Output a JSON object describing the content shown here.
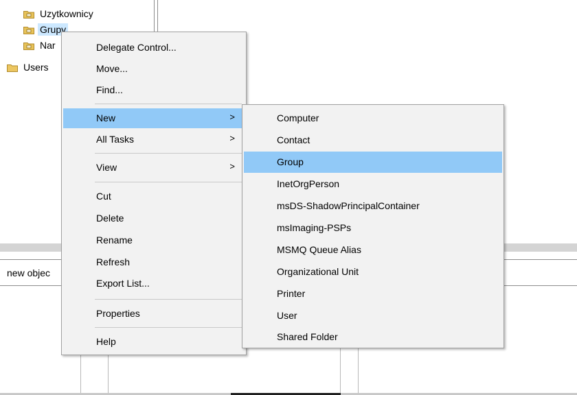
{
  "tree": {
    "items": [
      {
        "label": "Uzytkownicy"
      },
      {
        "label": "Grupy"
      },
      {
        "label": "Nar"
      },
      {
        "label": "Users"
      }
    ]
  },
  "status_text": "new objec",
  "context_menu": {
    "items": [
      {
        "label": "Delegate Control..."
      },
      {
        "label": "Move..."
      },
      {
        "label": "Find..."
      },
      {
        "label": "New",
        "arrow": ">"
      },
      {
        "label": "All Tasks",
        "arrow": ">"
      },
      {
        "label": "View",
        "arrow": ">"
      },
      {
        "label": "Cut"
      },
      {
        "label": "Delete"
      },
      {
        "label": "Rename"
      },
      {
        "label": "Refresh"
      },
      {
        "label": "Export List..."
      },
      {
        "label": "Properties"
      },
      {
        "label": "Help"
      }
    ]
  },
  "submenu": {
    "items": [
      {
        "label": "Computer"
      },
      {
        "label": "Contact"
      },
      {
        "label": "Group"
      },
      {
        "label": "InetOrgPerson"
      },
      {
        "label": "msDS-ShadowPrincipalContainer"
      },
      {
        "label": "msImaging-PSPs"
      },
      {
        "label": "MSMQ Queue Alias"
      },
      {
        "label": "Organizational Unit"
      },
      {
        "label": "Printer"
      },
      {
        "label": "User"
      },
      {
        "label": "Shared Folder"
      }
    ]
  },
  "colors": {
    "highlight": "#91c9f7",
    "menu_bg": "#f2f2f2",
    "folder": "#e8c35a"
  }
}
